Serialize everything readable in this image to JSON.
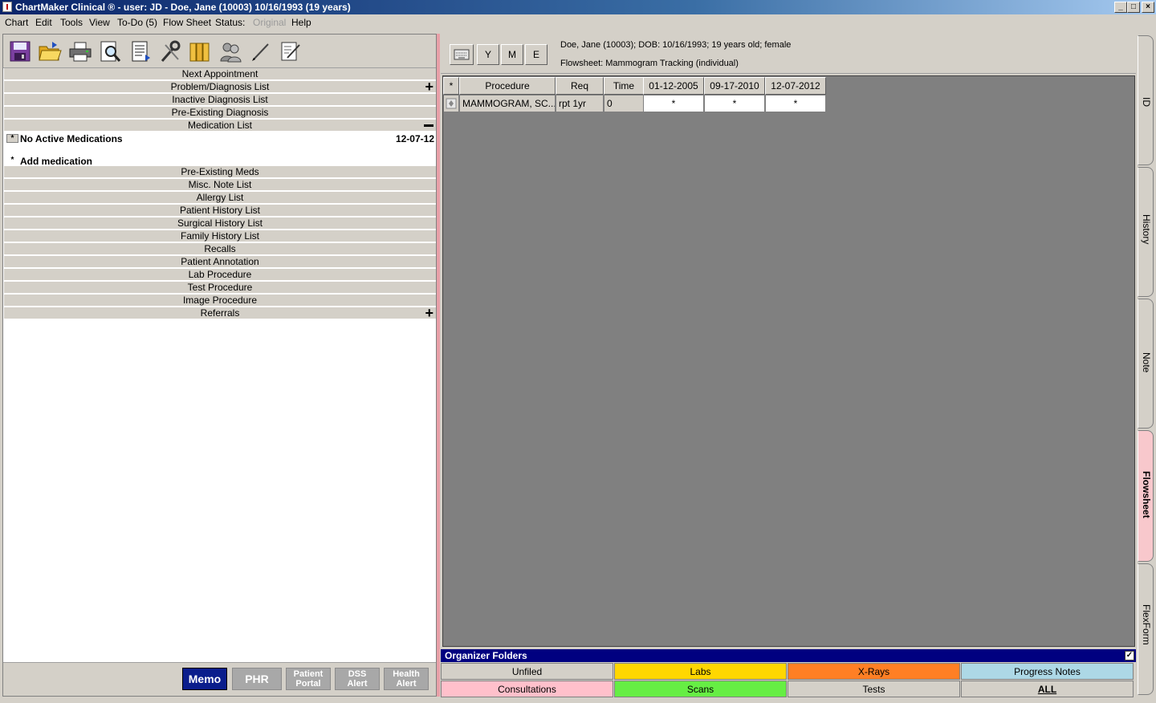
{
  "window": {
    "title": "ChartMaker Clinical ® - user: JD - Doe, Jane (10003) 10/16/1993 (19 years)",
    "min_label": "_",
    "max_label": "□",
    "close_label": "×"
  },
  "menu": [
    {
      "label": "Chart",
      "disabled": false
    },
    {
      "label": "Edit",
      "disabled": false
    },
    {
      "label": "Tools",
      "disabled": false
    },
    {
      "label": "View",
      "disabled": false
    },
    {
      "label": "To-Do (5)",
      "disabled": false
    },
    {
      "label": "Flow Sheet",
      "disabled": false
    },
    {
      "label": "Status:",
      "disabled": false
    },
    {
      "label": "Original",
      "disabled": true
    },
    {
      "label": "Help",
      "disabled": false
    }
  ],
  "toolbar_icons": [
    "save-icon",
    "open-folder-icon",
    "print-icon",
    "preview-icon",
    "document-list-icon",
    "tools-icon",
    "folders-icon",
    "users-icon",
    "pen-icon",
    "note-edit-icon"
  ],
  "summary_list": {
    "next_appointment": "Next Appointment",
    "problem_list": "Problem/Diagnosis List",
    "inactive_dx": "Inactive Diagnosis List",
    "preexisting_dx": "Pre-Existing Diagnosis",
    "medication_list": "Medication List",
    "no_active_meds": "No Active Medications",
    "no_active_meds_date": "12-07-12",
    "add_medication": "Add medication",
    "star": "*",
    "preexisting_meds": "Pre-Existing Meds",
    "misc_note": "Misc. Note List",
    "allergy": "Allergy List",
    "patient_history": "Patient History List",
    "surgical_history": "Surgical History List",
    "family_history": "Family History List",
    "recalls": "Recalls",
    "patient_annotation": "Patient Annotation",
    "lab_procedure": "Lab Procedure",
    "test_procedure": "Test Procedure",
    "image_procedure": "Image Procedure",
    "referrals": "Referrals"
  },
  "bottom_buttons": {
    "memo": "Memo",
    "phr": "PHR",
    "patient_portal_1": "Patient",
    "patient_portal_2": "Portal",
    "dss_1": "DSS",
    "dss_2": "Alert",
    "health_1": "Health",
    "health_2": "Alert"
  },
  "header": {
    "patient_info": "Doe, Jane (10003); DOB: 10/16/1993; 19 years old; female",
    "flowsheet_label": "Flowsheet:  Mammogram Tracking (individual)",
    "btn_y": "Y",
    "btn_m": "M",
    "btn_e": "E"
  },
  "flowsheet": {
    "columns": [
      "*",
      "Procedure",
      "Req",
      "Time",
      "01-12-2005",
      "09-17-2010",
      "12-07-2012"
    ],
    "row": {
      "procedure": "MAMMOGRAM, SC...",
      "req": "rpt 1yr",
      "time": "0",
      "v1": "*",
      "v2": "*",
      "v3": "*"
    }
  },
  "organizer": {
    "title": "Organizer Folders",
    "folders": [
      {
        "label": "Unfiled",
        "color": "#d4d0c8"
      },
      {
        "label": "Labs",
        "color": "#ffd700"
      },
      {
        "label": "X-Rays",
        "color": "#ff7f24"
      },
      {
        "label": "Progress Notes",
        "color": "#add8e6"
      },
      {
        "label": "Consultations",
        "color": "#ffc0cb"
      },
      {
        "label": "Scans",
        "color": "#66ee44"
      },
      {
        "label": "Tests",
        "color": "#d4d0c8"
      },
      {
        "label": "ALL",
        "color": "#d4d0c8"
      }
    ]
  },
  "side_tabs": {
    "id": "ID",
    "history": "History",
    "note": "Note",
    "flowsheet": "Flowsheet",
    "flexform": "FlexForm"
  }
}
